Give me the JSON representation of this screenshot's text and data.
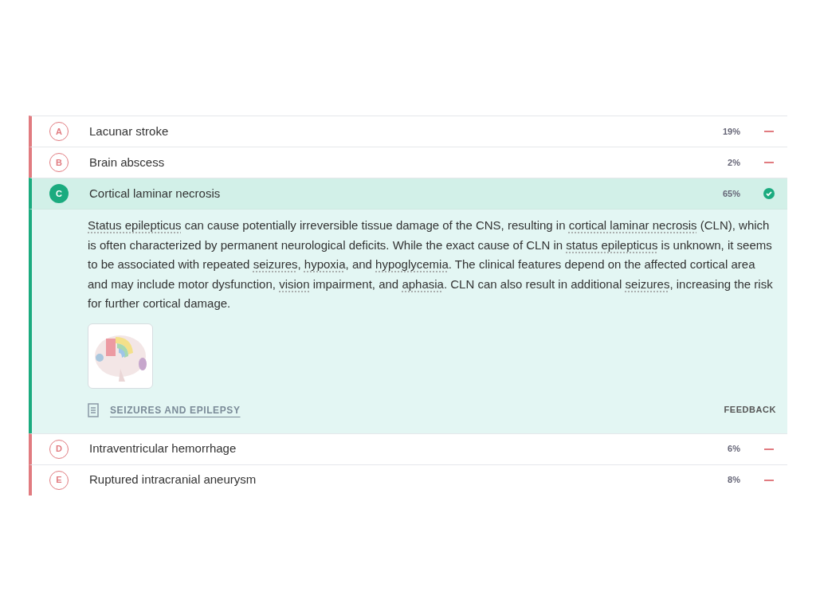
{
  "options": [
    {
      "letter": "A",
      "text": "Lacunar stroke",
      "percent": "19%",
      "correct": false,
      "expanded": false
    },
    {
      "letter": "B",
      "text": "Brain abscess",
      "percent": "2%",
      "correct": false,
      "expanded": false
    },
    {
      "letter": "C",
      "text": "Cortical laminar necrosis",
      "percent": "65%",
      "correct": true,
      "expanded": true,
      "explanation": [
        {
          "kind": "term",
          "text": "Status epilepticus"
        },
        {
          "kind": "plain",
          "text": " can cause potentially irreversible tissue damage of the CNS, resulting in "
        },
        {
          "kind": "term",
          "text": "cortical laminar necrosis"
        },
        {
          "kind": "plain",
          "text": " (CLN), which is often characterized by permanent neurological deficits. While the exact cause of CLN in "
        },
        {
          "kind": "term",
          "text": "status epilepticus"
        },
        {
          "kind": "plain",
          "text": " is unknown, it seems to be associated with repeated "
        },
        {
          "kind": "term",
          "text": "seizures"
        },
        {
          "kind": "plain",
          "text": ", "
        },
        {
          "kind": "term",
          "text": "hypoxia"
        },
        {
          "kind": "plain",
          "text": ", and "
        },
        {
          "kind": "term",
          "text": "hypoglycemia"
        },
        {
          "kind": "plain",
          "text": ". The clinical features depend on the affected cortical area and may include motor dysfunction, "
        },
        {
          "kind": "term",
          "text": "vision"
        },
        {
          "kind": "plain",
          "text": " impairment, and "
        },
        {
          "kind": "term",
          "text": "aphasia"
        },
        {
          "kind": "plain",
          "text": ". CLN can also result in additional "
        },
        {
          "kind": "term",
          "text": "seizures"
        },
        {
          "kind": "plain",
          "text": ", increasing the risk for further cortical damage."
        }
      ],
      "article": "SEIZURES AND EPILEPSY",
      "feedback": "FEEDBACK"
    },
    {
      "letter": "D",
      "text": "Intraventricular hemorrhage",
      "percent": "6%",
      "correct": false,
      "expanded": false
    },
    {
      "letter": "E",
      "text": "Ruptured intracranial aneurysm",
      "percent": "8%",
      "correct": false,
      "expanded": false
    }
  ]
}
